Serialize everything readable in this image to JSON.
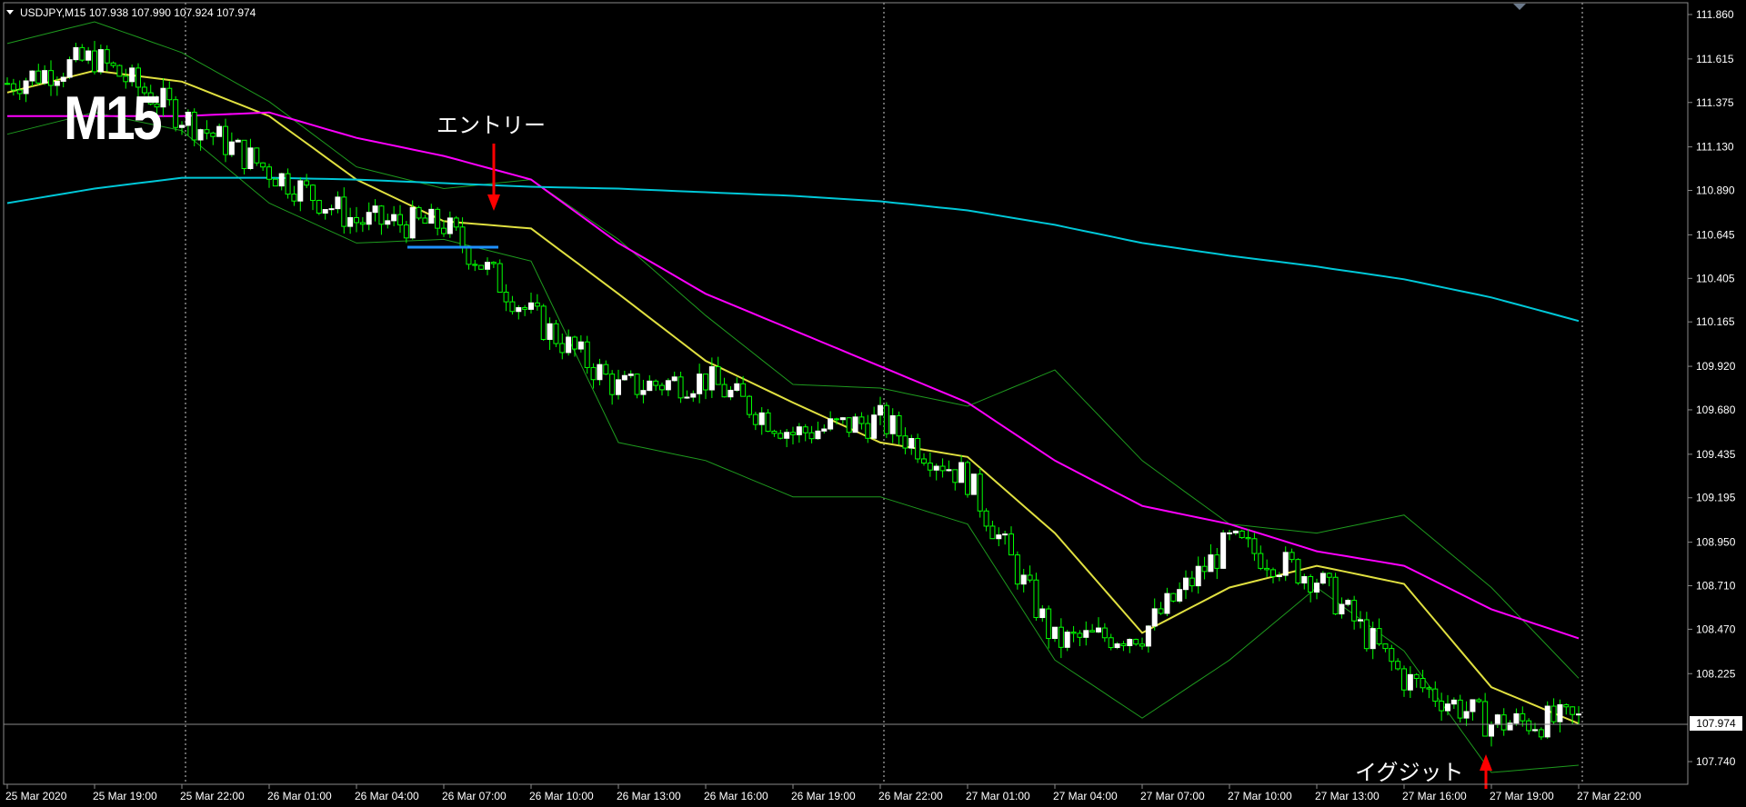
{
  "header": {
    "symbol_label": "USDJPY,M15",
    "ohlc": "107.938 107.990 107.924 107.974"
  },
  "timeframe_label": "M15",
  "annotations": {
    "entry": "エントリー",
    "exit": "イグジット"
  },
  "current_price": "107.974",
  "colors": {
    "background": "#000000",
    "bull_candle": "#ffffff",
    "candle_wick": "#00ff00",
    "ma_short": "#e0e040",
    "ma_mid": "#ff00ff",
    "ma_long": "#00c8d8",
    "bollinger": "#1e9a1e",
    "arrow": "#ff0000",
    "support_line": "#1e90ff",
    "text": "#ffffff"
  },
  "chart_data": {
    "type": "candlestick",
    "symbol": "USDJPY",
    "timeframe": "M15",
    "ylim": [
      107.62,
      111.9
    ],
    "grid": "vertical dotted separators only",
    "y_ticks": [
      "111.860",
      "111.615",
      "111.375",
      "111.130",
      "110.890",
      "110.645",
      "110.405",
      "110.165",
      "109.920",
      "109.680",
      "109.435",
      "109.195",
      "108.950",
      "108.710",
      "108.470",
      "108.225",
      "107.974",
      "107.740"
    ],
    "y_tick_values": [
      111.86,
      111.615,
      111.375,
      111.13,
      110.89,
      110.645,
      110.405,
      110.165,
      109.92,
      109.68,
      109.435,
      109.195,
      108.95,
      108.71,
      108.47,
      108.225,
      107.974,
      107.74
    ],
    "x_ticks": [
      "25 Mar 2020",
      "25 Mar 19:00",
      "25 Mar 22:00",
      "26 Mar 01:00",
      "26 Mar 04:00",
      "26 Mar 07:00",
      "26 Mar 10:00",
      "26 Mar 13:00",
      "26 Mar 16:00",
      "26 Mar 19:00",
      "26 Mar 22:00",
      "27 Mar 01:00",
      "27 Mar 04:00",
      "27 Mar 07:00",
      "27 Mar 10:00",
      "27 Mar 13:00",
      "27 Mar 16:00",
      "27 Mar 19:00",
      "27 Mar 22:00"
    ],
    "vertical_separators": [
      "25 Mar 22:00",
      "26 Mar 22:00",
      "27 Mar 22:00"
    ],
    "close_path": [
      {
        "t": "25 Mar 2020",
        "v": 111.48
      },
      {
        "t": "25 Mar 19:00",
        "v": 111.62
      },
      {
        "t": "25 Mar 22:00",
        "v": 111.3
      },
      {
        "t": "26 Mar 01:00",
        "v": 111.0
      },
      {
        "t": "26 Mar 04:00",
        "v": 110.72
      },
      {
        "t": "26 Mar 07:00",
        "v": 110.7
      },
      {
        "t": "26 Mar 10:00",
        "v": 110.2
      },
      {
        "t": "26 Mar 13:00",
        "v": 109.8
      },
      {
        "t": "26 Mar 16:00",
        "v": 109.85
      },
      {
        "t": "26 Mar 19:00",
        "v": 109.55
      },
      {
        "t": "26 Mar 22:00",
        "v": 109.62
      },
      {
        "t": "27 Mar 01:00",
        "v": 109.3
      },
      {
        "t": "27 Mar 04:00",
        "v": 108.4
      },
      {
        "t": "27 Mar 07:00",
        "v": 108.45
      },
      {
        "t": "27 Mar 10:00",
        "v": 108.95
      },
      {
        "t": "27 Mar 13:00",
        "v": 108.75
      },
      {
        "t": "27 Mar 16:00",
        "v": 108.2
      },
      {
        "t": "27 Mar 19:00",
        "v": 107.95
      },
      {
        "t": "27 Mar 22:00",
        "v": 107.97
      }
    ],
    "series": [
      {
        "style": "ma_short",
        "values": [
          111.43,
          111.55,
          111.49,
          111.3,
          110.95,
          110.72,
          110.68,
          110.32,
          109.95,
          109.72,
          109.5,
          109.42,
          109.0,
          108.45,
          108.7,
          108.82,
          108.72,
          108.15,
          107.95
        ]
      },
      {
        "style": "ma_mid",
        "values": [
          111.3,
          111.3,
          111.3,
          111.32,
          111.18,
          111.08,
          110.95,
          110.6,
          110.32,
          110.12,
          109.92,
          109.72,
          109.4,
          109.15,
          109.05,
          108.9,
          108.82,
          108.58,
          108.42
        ]
      },
      {
        "style": "ma_long",
        "values": [
          110.82,
          110.9,
          110.96,
          110.96,
          110.95,
          110.93,
          110.91,
          110.9,
          110.88,
          110.86,
          110.83,
          110.78,
          110.7,
          110.6,
          110.53,
          110.47,
          110.4,
          110.3,
          110.17
        ]
      },
      {
        "style": "bollinger",
        "values": [
          111.7,
          111.82,
          111.65,
          111.38,
          111.02,
          110.9,
          110.95,
          110.62,
          110.2,
          109.82,
          109.8,
          109.7,
          109.9,
          109.4,
          109.05,
          109.0,
          109.1,
          108.7,
          108.2
        ]
      },
      {
        "style": "bollinger",
        "values": [
          111.2,
          111.32,
          111.22,
          110.82,
          110.6,
          110.62,
          110.5,
          109.5,
          109.4,
          109.2,
          109.2,
          109.05,
          108.3,
          107.98,
          108.3,
          108.7,
          108.35,
          107.68,
          107.72
        ]
      }
    ],
    "entry_level": 110.6,
    "exit_price": 107.74
  }
}
